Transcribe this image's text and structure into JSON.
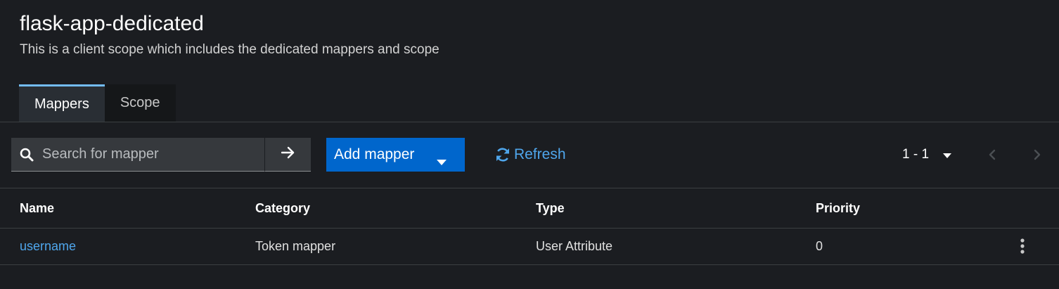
{
  "header": {
    "title": "flask-app-dedicated",
    "subtitle": "This is a client scope which includes the dedicated mappers and scope"
  },
  "tabs": [
    {
      "label": "Mappers",
      "active": true
    },
    {
      "label": "Scope",
      "active": false
    }
  ],
  "toolbar": {
    "search_placeholder": "Search for mapper",
    "search_value": "",
    "add_mapper_label": "Add mapper",
    "refresh_label": "Refresh",
    "pagination_label": "1 - 1"
  },
  "table": {
    "columns": [
      "Name",
      "Category",
      "Type",
      "Priority"
    ],
    "rows": [
      {
        "name": "username",
        "category": "Token mapper",
        "type": "User Attribute",
        "priority": "0"
      }
    ]
  },
  "icons": {
    "search": "search-icon",
    "arrow": "arrow-right-icon",
    "caret": "caret-down-icon",
    "refresh": "sync-icon",
    "prev": "angle-left-icon",
    "next": "angle-right-icon",
    "kebab": "kebab-menu-icon"
  },
  "colors": {
    "background": "#1b1d21",
    "primary": "#0066cc",
    "link": "#4fa6ec",
    "active_tab_border": "#73bcf7"
  }
}
